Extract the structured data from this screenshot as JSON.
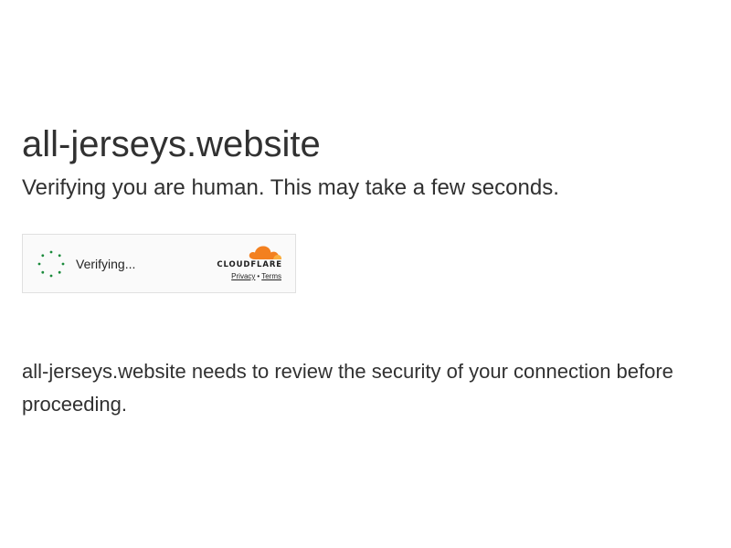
{
  "page": {
    "site_title": "all-jerseys.website",
    "subtitle": "Verifying you are human. This may take a few seconds.",
    "body_text": "all-jerseys.website needs to review the security of your connection before proceeding."
  },
  "widget": {
    "status_text": "Verifying...",
    "brand_name": "CLOUDFLARE",
    "privacy_label": "Privacy",
    "separator": "•",
    "terms_label": "Terms",
    "spinner_color": "#1a8a3b",
    "brand_color": "#f38020"
  }
}
